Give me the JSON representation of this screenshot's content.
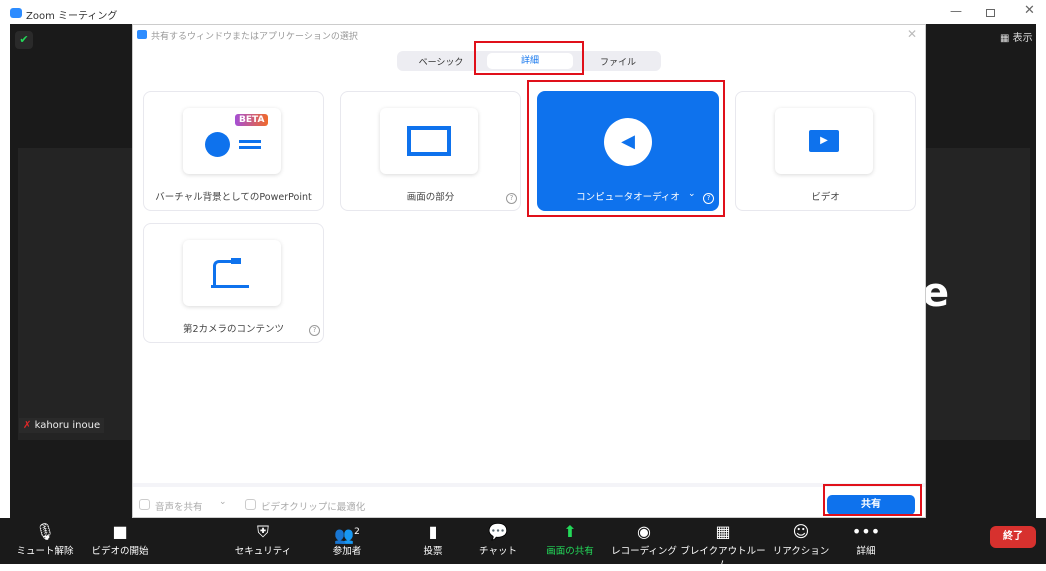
{
  "window": {
    "title": "Zoom ミーティング",
    "view_label": "表示"
  },
  "participant": {
    "name": "kahoru inoue",
    "big_initial": "e"
  },
  "dialog": {
    "title": "共有するウィンドウまたはアプリケーションの選択",
    "tabs": [
      {
        "label": "ベーシック"
      },
      {
        "label": "詳細",
        "selected": true
      },
      {
        "label": "ファイル"
      }
    ],
    "options": [
      {
        "label": "バーチャル背景としてのPowerPoint",
        "badge": "BETA"
      },
      {
        "label": "画面の部分"
      },
      {
        "label": "コンピュータオーディオ",
        "selected": true
      },
      {
        "label": "ビデオ"
      },
      {
        "label": "第2カメラのコンテンツ"
      }
    ],
    "share_sound": "音声を共有",
    "optimize_video": "ビデオクリップに最適化",
    "share_button": "共有",
    "help": "?"
  },
  "toolbar": {
    "items": [
      {
        "label": "ミュート解除"
      },
      {
        "label": "ビデオの開始"
      },
      {
        "label": "セキュリティ"
      },
      {
        "label": "参加者",
        "count": "2"
      },
      {
        "label": "投票"
      },
      {
        "label": "チャット"
      },
      {
        "label": "画面の共有"
      },
      {
        "label": "レコーディング"
      },
      {
        "label": "ブレイクアウトルーム"
      },
      {
        "label": "リアクション"
      },
      {
        "label": "詳細"
      }
    ],
    "end_button": "終了"
  },
  "colors": {
    "accent": "#0e72ed",
    "highlight": "#e0101a",
    "share_green": "#23d959"
  }
}
